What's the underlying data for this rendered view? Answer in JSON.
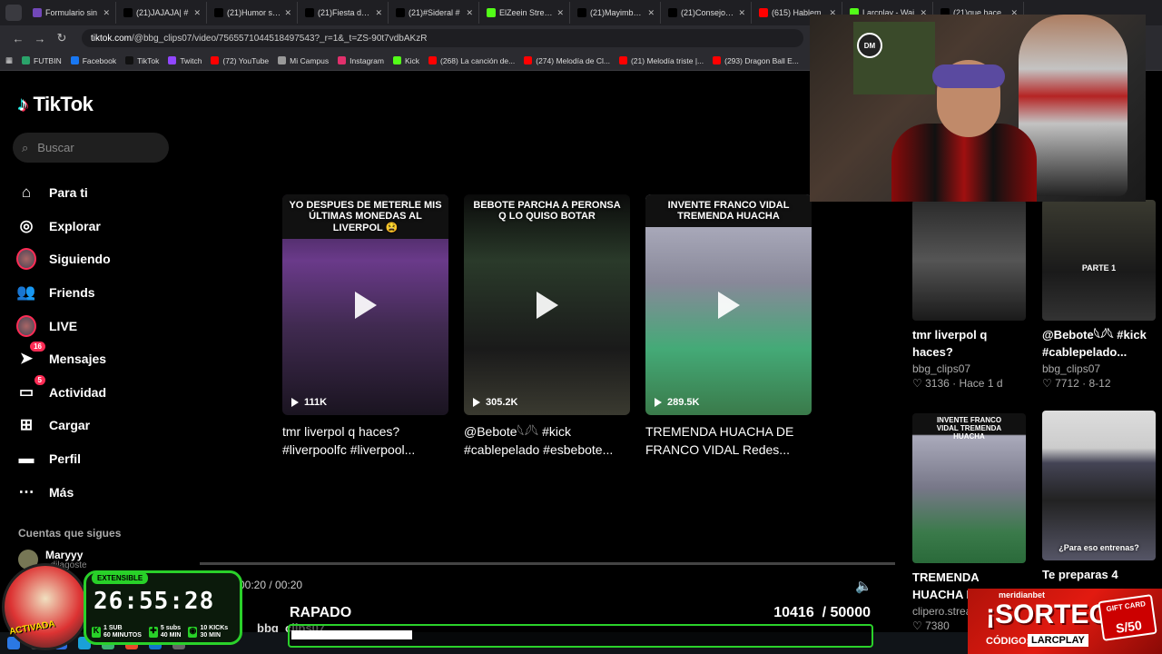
{
  "browser": {
    "tabs": [
      {
        "label": "Formulario sin",
        "color": "#7248b9"
      },
      {
        "label": "(21)JAJAJA| #",
        "color": "#000000"
      },
      {
        "label": "(21)Humor sob",
        "color": "#000000"
      },
      {
        "label": "(21)Fiesta de F",
        "color": "#000000"
      },
      {
        "label": "(21)#Sideral #",
        "color": "#000000"
      },
      {
        "label": "ElZeein Stream",
        "color": "#53fc18"
      },
      {
        "label": "(21)Mayimbu y",
        "color": "#000000"
      },
      {
        "label": "(21)Consejo de",
        "color": "#000000"
      },
      {
        "label": "(615) Hablem",
        "color": "#ff0000"
      },
      {
        "label": "Larcplay - Wai",
        "color": "#53fc18"
      },
      {
        "label": "(21)que hace",
        "color": "#000000"
      }
    ],
    "url_domain": "tiktok.com",
    "url_path": "/@bbg_clips07/video/7565571044518497543?_r=1&_t=ZS-90t7vdbAKzR",
    "bookmarks": [
      {
        "label": "FUTBIN",
        "color": "#2aa36a"
      },
      {
        "label": "Facebook",
        "color": "#1877f2"
      },
      {
        "label": "TikTok",
        "color": "#111111"
      },
      {
        "label": "Twitch",
        "color": "#9146ff"
      },
      {
        "label": "(72) YouTube",
        "color": "#ff0000"
      },
      {
        "label": "Mi Campus",
        "color": "#999999"
      },
      {
        "label": "Instagram",
        "color": "#e1306c"
      },
      {
        "label": "Kick",
        "color": "#53fc18"
      },
      {
        "label": "(268) La canción de...",
        "color": "#ff0000"
      },
      {
        "label": "(274) Melodía de Cl...",
        "color": "#ff0000"
      },
      {
        "label": "(21) Melodía triste |...",
        "color": "#ff0000"
      },
      {
        "label": "(293) Dragon Ball E...",
        "color": "#ff0000"
      }
    ]
  },
  "tiktok": {
    "brand": "TikTok",
    "search_placeholder": "Buscar",
    "nav": [
      {
        "label": "Para ti",
        "icon": "home-icon",
        "glyph": "⌂"
      },
      {
        "label": "Explorar",
        "icon": "compass-icon",
        "glyph": "◎"
      },
      {
        "label": "Siguiendo",
        "icon": "following-avatar-icon",
        "glyph": ""
      },
      {
        "label": "Friends",
        "icon": "friends-icon",
        "glyph": "👥"
      },
      {
        "label": "LIVE",
        "icon": "live-avatar-icon",
        "glyph": ""
      },
      {
        "label": "Mensajes",
        "icon": "messages-icon",
        "glyph": "➤",
        "badge": "16"
      },
      {
        "label": "Actividad",
        "icon": "activity-icon",
        "glyph": "▭",
        "badge": "5"
      },
      {
        "label": "Cargar",
        "icon": "upload-icon",
        "glyph": "⊞"
      },
      {
        "label": "Perfil",
        "icon": "profile-icon",
        "glyph": "▬"
      },
      {
        "label": "Más",
        "icon": "more-icon",
        "glyph": "⋯"
      }
    ],
    "following_title": "Cuentas que sigues",
    "following": [
      {
        "name": "Maryyy",
        "handle": "..dilagoste"
      }
    ],
    "grid": [
      {
        "caption": "YO DESPUES DE METERLE MIS ÚLTIMAS MONEDAS AL LIVERPOL 😫",
        "views": "111K",
        "desc": "tmr liverpol q haces? #liverpoolfc #liverpool..."
      },
      {
        "caption": "BEBOTE PARCHA A PERONSA Q LO QUISO BOTAR",
        "views": "305.2K",
        "desc": "@Bebote𓆩𓆪𓆩 #kick #cablepelado #esbebote..."
      },
      {
        "caption": "INVENTE FRANCO VIDAL TREMENDA HUACHA",
        "views": "289.5K",
        "desc": "TREMENDA HUACHA DE FRANCO VIDAL Redes..."
      }
    ],
    "player": {
      "time": "00:20 / 00:20"
    },
    "related": [
      {
        "desc": "tmr liverpol q haces? #liverpoolfc...",
        "user": "bbg_clips07",
        "likes": "3136",
        "when": "Hace 1 d"
      },
      {
        "desc": "@Bebote𓆩𓆪𓆩 #kick #cablepelado...",
        "user": "bbg_clips07",
        "likes": "7712",
        "when": "8-12",
        "overlay": "PARTE 1"
      },
      {
        "desc": "TREMENDA HUACHA DE FRANCO...",
        "user": "clipero.strea",
        "likes": "7380",
        "when": "",
        "overlay": "INVENTE FRANCO VIDAL TREMENDA HUACHA"
      },
      {
        "desc": "Te preparas 4 meses",
        "user": "",
        "likes": "",
        "when": "",
        "overlay": "¿Para eso entrenas?"
      }
    ],
    "bottom_handle": "bbg_clips07"
  },
  "stream": {
    "extensible": "EXTENSIBLE",
    "timer": "26:55:28",
    "mascot_text": "ACTIVADA",
    "subs": [
      {
        "k": "1 SUB",
        "v": "60 MINUTOS"
      },
      {
        "k": "5 subs",
        "v": "40 MIN"
      },
      {
        "k": "10 KICKs",
        "v": "30 MIN"
      }
    ],
    "goal_title": "RAPADO",
    "goal_value": "10416",
    "goal_total": "/ 50000",
    "goal_fraction": 0.208,
    "promo_brand": "meridianbet",
    "promo_big": "¡SORTEO!",
    "promo_code_label": "CÓDIGO:",
    "promo_code": "LARCPLAY",
    "gift_label": "GIFT CARD",
    "gift_amount": "S/50"
  }
}
